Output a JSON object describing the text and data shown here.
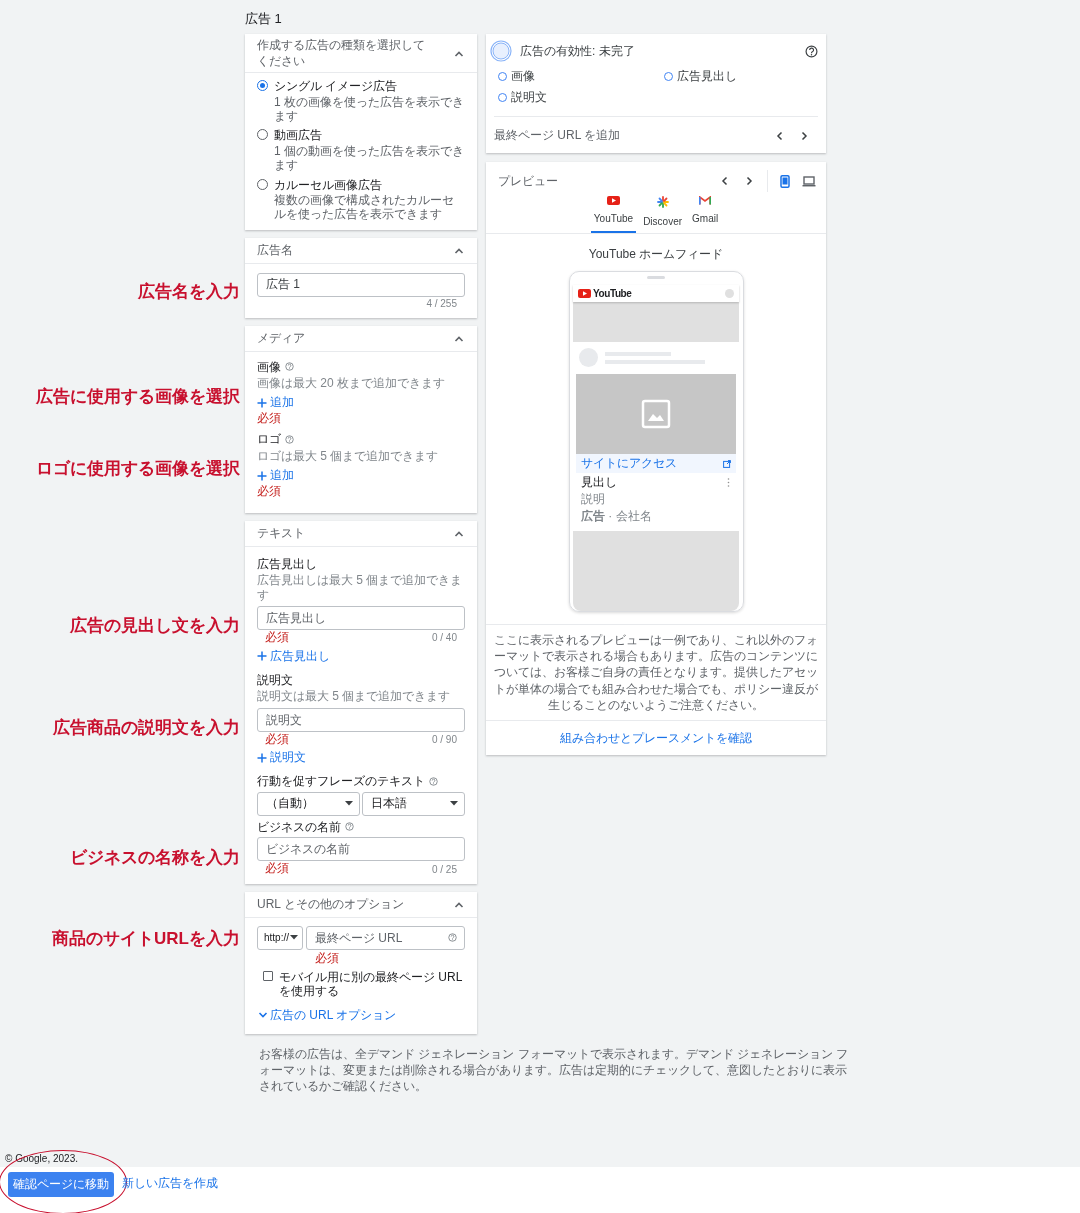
{
  "page_title": "広告 1",
  "ad_type": {
    "title": "作成する広告の種類を選択してください",
    "options": [
      {
        "label": "シングル イメージ広告",
        "description": "1 枚の画像を使った広告を表示できます",
        "selected": true
      },
      {
        "label": "動画広告",
        "description": "1 個の動画を使った広告を表示できます",
        "selected": false
      },
      {
        "label": "カルーセル画像広告",
        "description": "複数の画像で構成されたカルーセルを使った広告を表示できます",
        "selected": false
      }
    ]
  },
  "ad_name": {
    "title": "広告名",
    "value": "広告 1",
    "counter": "4 / 255",
    "annotation": "広告名を入力"
  },
  "media": {
    "title": "メディア",
    "sections": [
      {
        "label": "画像",
        "hint": "画像は最大 20 枚まで追加できます",
        "add": "追加",
        "required": "必須",
        "annotation": "広告に使用する画像を選択"
      },
      {
        "label": "ロゴ",
        "hint": "ロゴは最大 5 個まで追加できます",
        "add": "追加",
        "required": "必須",
        "annotation": "ロゴに使用する画像を選択"
      }
    ]
  },
  "text": {
    "title": "テキスト",
    "sections": [
      {
        "kind": "field",
        "label": "広告見出し",
        "hint": "広告見出しは最大 5 個まで追加できます",
        "placeholder": "広告見出し",
        "required": "必須",
        "counter": "0 / 40",
        "add": "広告見出し",
        "annotation": "広告の見出し文を入力"
      },
      {
        "kind": "field",
        "label": "説明文",
        "hint": "説明文は最大 5 個まで追加できます",
        "placeholder": "説明文",
        "required": "必須",
        "counter": "0 / 90",
        "add": "説明文",
        "annotation": "広告商品の説明文を入力"
      },
      {
        "kind": "dropdowns",
        "label": "行動を促すフレーズのテキスト",
        "dropdowns": [
          "（自動）",
          "日本語"
        ]
      },
      {
        "kind": "field",
        "label": "ビジネスの名前",
        "placeholder": "ビジネスの名前",
        "required": "必須",
        "counter": "0 / 25",
        "annotation": "ビジネスの名称を入力"
      }
    ]
  },
  "url": {
    "title": "URL とその他のオプション",
    "protocol": "http://",
    "placeholder": "最終ページ URL",
    "required": "必須",
    "annotation": "商品のサイトURLを入力",
    "mobile_url": {
      "label": "モバイル用に別の最終ページ URL を使用する",
      "checked": false
    },
    "options_link": "広告の URL オプション"
  },
  "strength": {
    "title": "広告の有効性: 未完了",
    "items": [
      {
        "label": "画像",
        "done": false
      },
      {
        "label": "広告見出し",
        "done": false
      },
      {
        "label": "説明文",
        "done": false
      }
    ],
    "footer": "最終ページ URL を追加"
  },
  "preview": {
    "title": "プレビュー",
    "devices": [
      {
        "kind": "mobile",
        "selected": true
      },
      {
        "kind": "desktop",
        "selected": false
      }
    ],
    "tabs": [
      {
        "kind": "youtube",
        "label": "YouTube",
        "selected": true
      },
      {
        "kind": "discover",
        "label": "Discover",
        "selected": false
      },
      {
        "kind": "gmail",
        "label": "Gmail",
        "selected": false
      }
    ],
    "placement": "YouTube ホームフィード",
    "phone": {
      "logo": "YouTube",
      "cta": "サイトにアクセス",
      "headline": "見出し",
      "description": "説明",
      "meta": "**広告** · 会社名"
    },
    "disclaimer": "ここに表示されるプレビューは一例であり、これ以外のフォーマットで表示される場合もあります。広告のコンテンツについては、お客様ご自身の責任となります。提供したアセットが単体の場合でも組み合わせた場合でも、ポリシー違反が生じることのないようご注意ください。",
    "link": "組み合わせとプレースメントを確認"
  },
  "notice": "お客様の広告は、全デマンド ジェネレーション フォーマットで表示されます。デマンド ジェネレーション フォーマットは、変更または削除される場合があります。広告は定期的にチェックして、意図したとおりに表示されているかご確認ください。",
  "copyright": "© Google, 2023.",
  "footer_buttons": [
    {
      "kind": "primary",
      "label": "確認ページに移動",
      "circled": true
    },
    {
      "kind": "link",
      "label": "新しい広告を作成",
      "circled": false
    }
  ]
}
